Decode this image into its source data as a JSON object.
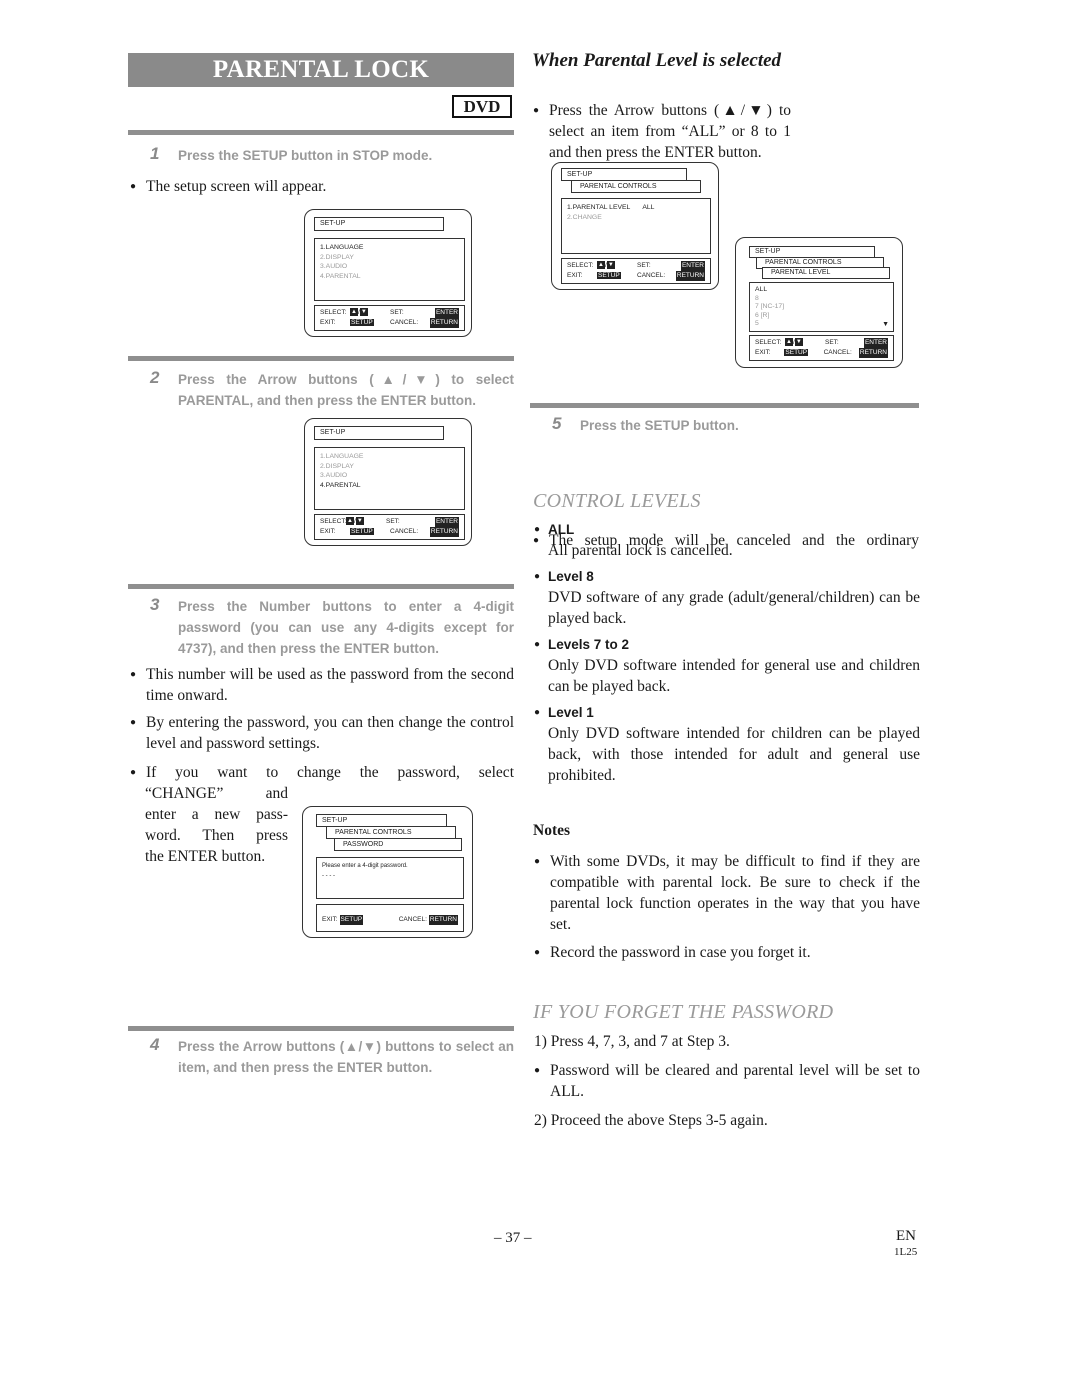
{
  "page": {
    "title": "PARENTAL LOCK",
    "badge": "DVD",
    "page_number": "– 37 –",
    "lang": "EN",
    "code": "1L25"
  },
  "steps": [
    {
      "num": "1",
      "text": "Press the SETUP button in STOP mode."
    },
    {
      "num": "2",
      "text": "Press the Arrow buttons (▲/▼) to select PARENTAL, and then press the ENTER button."
    },
    {
      "num": "3",
      "text": "Press the Number buttons to enter a 4-digit password (you can use any 4-digits except for  4737), and then press the ENTER button."
    },
    {
      "num": "4",
      "text": "Press the Arrow buttons (▲/▼) buttons to select an item, and then press the ENTER button."
    },
    {
      "num": "5",
      "text": "Press the SETUP button."
    }
  ],
  "step1_bullets": [
    "The setup screen will appear."
  ],
  "step3_bullets": [
    "This number will be used as the password from the second time onward.",
    "By entering the password, you can then change the control level and password settings.",
    "If you want to change the password, select “CHANGE” and enter a new password. Then press the ENTER button."
  ],
  "step3_change_lines": [
    "If you want to change the password, select",
    "“CHANGE” and",
    "enter a new pass-",
    "word. Then press",
    "the ENTER button."
  ],
  "parental_level": {
    "heading": "When Parental Level is selected",
    "bullet": "Press the Arrow buttons (▲/▼)  to select an item from “ALL” or 8 to 1 and then press the ENTER button."
  },
  "step5_bullets": [
    "The setup mode will be canceled and the ordinary"
  ],
  "control_levels": {
    "heading": "CONTROL LEVELS",
    "items": [
      {
        "title": "ALL",
        "desc": "All parental lock is cancelled."
      },
      {
        "title": "Level 8",
        "desc": "DVD software of any grade (adult/general/children) can be played back."
      },
      {
        "title": "Levels 7 to 2",
        "desc": "Only DVD software intended for general use and children can be played back."
      },
      {
        "title": "Level 1",
        "desc": "Only DVD software intended for children can be played back, with those intended for adult and general use prohibited."
      }
    ]
  },
  "notes": {
    "heading": "Notes",
    "items": [
      "With some DVDs, it may be difficult to find if they are compatible with parental lock. Be sure to check if the parental lock function operates in the way that you have set.",
      "Record the password in case you forget it."
    ]
  },
  "forget": {
    "heading": "IF YOU FORGET THE PASSWORD",
    "step1": "1) Press 4, 7, 3, and 7 at Step 3.",
    "bullet": "Password will be cleared and parental level will be set to ALL.",
    "step2": "2) Proceed the above Steps 3-5 again."
  },
  "osd": {
    "setup": "SET-UP",
    "parental_controls": "PARENTAL CONTROLS",
    "password": "PASSWORD",
    "parental_level": "PARENTAL LEVEL",
    "menu": [
      "1.LANGUAGE",
      "2.DISPLAY",
      "3.AUDIO",
      "4.PARENTAL"
    ],
    "select": "SELECT:",
    "set": "SET:",
    "exit": "EXIT:",
    "cancel": "CANCEL:",
    "enter_key": "ENTER",
    "setup_key": "SETUP",
    "return_key": "RETURN",
    "up": "▲",
    "slash": "/",
    "down": "▼",
    "pw_prompt": "Please enter a 4-digit password.",
    "pw_dashes": "- - - -",
    "pc_items": [
      "1.PARENTAL LEVEL",
      "ALL",
      "2.CHANGE"
    ],
    "levels": [
      "ALL",
      "8",
      "7 [NC-17]",
      "6 [R]",
      "5"
    ],
    "scroll_down": "▼"
  }
}
